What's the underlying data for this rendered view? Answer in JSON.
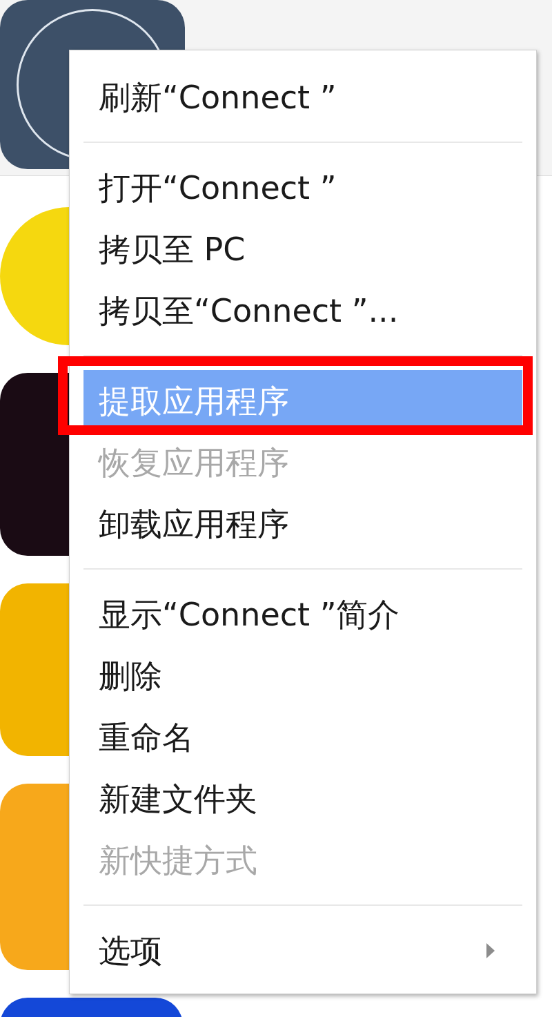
{
  "context_menu": {
    "sections": [
      [
        {
          "label": "刷新“Connect ”",
          "disabled": false,
          "selected": false,
          "annotated": false,
          "submenu": false
        }
      ],
      [
        {
          "label": "打开“Connect ”",
          "disabled": false,
          "selected": false,
          "annotated": false,
          "submenu": false
        },
        {
          "label": "拷贝至 PC",
          "disabled": false,
          "selected": false,
          "annotated": false,
          "submenu": false
        },
        {
          "label": "拷贝至“Connect ”...",
          "disabled": false,
          "selected": false,
          "annotated": false,
          "submenu": false
        }
      ],
      [
        {
          "label": "提取应用程序",
          "disabled": false,
          "selected": true,
          "annotated": true,
          "submenu": false
        },
        {
          "label": "恢复应用程序",
          "disabled": true,
          "selected": false,
          "annotated": false,
          "submenu": false
        },
        {
          "label": "卸载应用程序",
          "disabled": false,
          "selected": false,
          "annotated": false,
          "submenu": false
        }
      ],
      [
        {
          "label": "显示“Connect ”简介",
          "disabled": false,
          "selected": false,
          "annotated": false,
          "submenu": false
        },
        {
          "label": "删除",
          "disabled": false,
          "selected": false,
          "annotated": false,
          "submenu": false
        },
        {
          "label": "重命名",
          "disabled": false,
          "selected": false,
          "annotated": false,
          "submenu": false
        },
        {
          "label": "新建文件夹",
          "disabled": false,
          "selected": false,
          "annotated": false,
          "submenu": false
        },
        {
          "label": "新快捷方式",
          "disabled": true,
          "selected": false,
          "annotated": false,
          "submenu": false
        }
      ],
      [
        {
          "label": "选项",
          "disabled": false,
          "selected": false,
          "annotated": false,
          "submenu": true
        }
      ]
    ]
  }
}
